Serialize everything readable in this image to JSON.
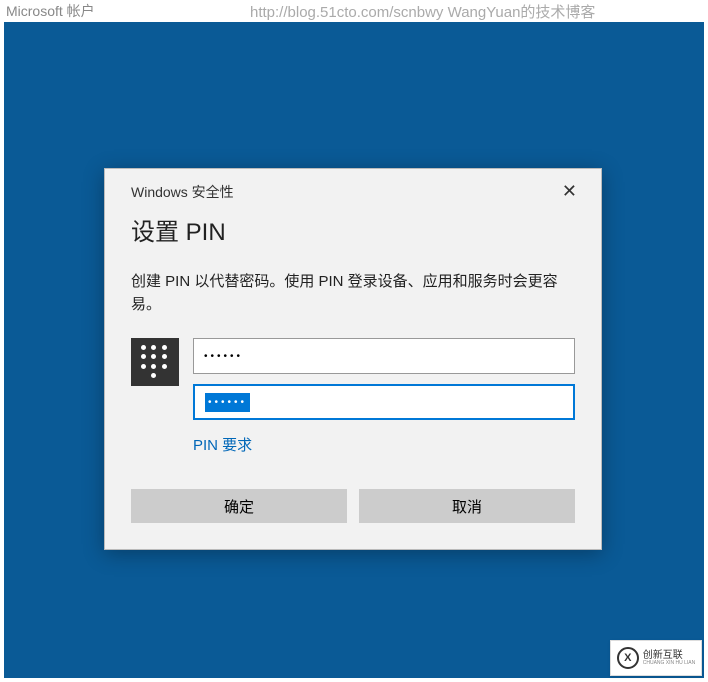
{
  "topbar": {
    "title": "Microsoft 帐户",
    "url": "http://blog.51cto.com/scnbwy WangYuan的技术博客"
  },
  "dialog": {
    "security_label": "Windows 安全性",
    "title": "设置 PIN",
    "description": "创建 PIN 以代替密码。使用 PIN 登录设备、应用和服务时会更容易。",
    "pin1_value": "••••••",
    "pin2_value": "••••••",
    "pin_requirements": "PIN 要求",
    "ok_label": "确定",
    "cancel_label": "取消"
  },
  "watermark": {
    "line1": "创新互联",
    "line2": "CHUANG XIN HU LIAN"
  }
}
